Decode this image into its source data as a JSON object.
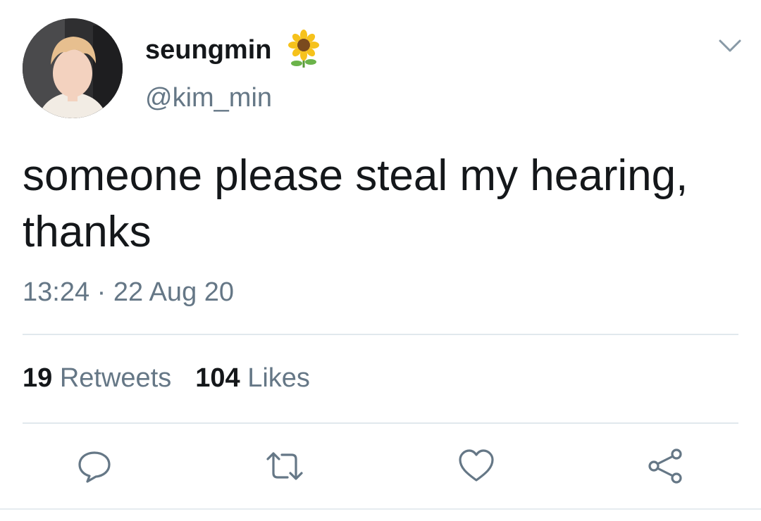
{
  "tweet": {
    "display_name": "seungmin",
    "name_emoji": "sunflower-icon",
    "handle": "@kim_min",
    "text": "someone please steal my hearing, thanks",
    "timestamp": "13:24 · 22 Aug 20",
    "stats": {
      "retweets_count": "19",
      "retweets_label": "Retweets",
      "likes_count": "104",
      "likes_label": "Likes"
    },
    "actions": [
      "reply-icon",
      "retweet-icon",
      "like-icon",
      "share-icon"
    ]
  },
  "colors": {
    "text_primary": "#14171a",
    "text_secondary": "#657786",
    "divider": "#e1e8ed",
    "icon": "#657786"
  }
}
